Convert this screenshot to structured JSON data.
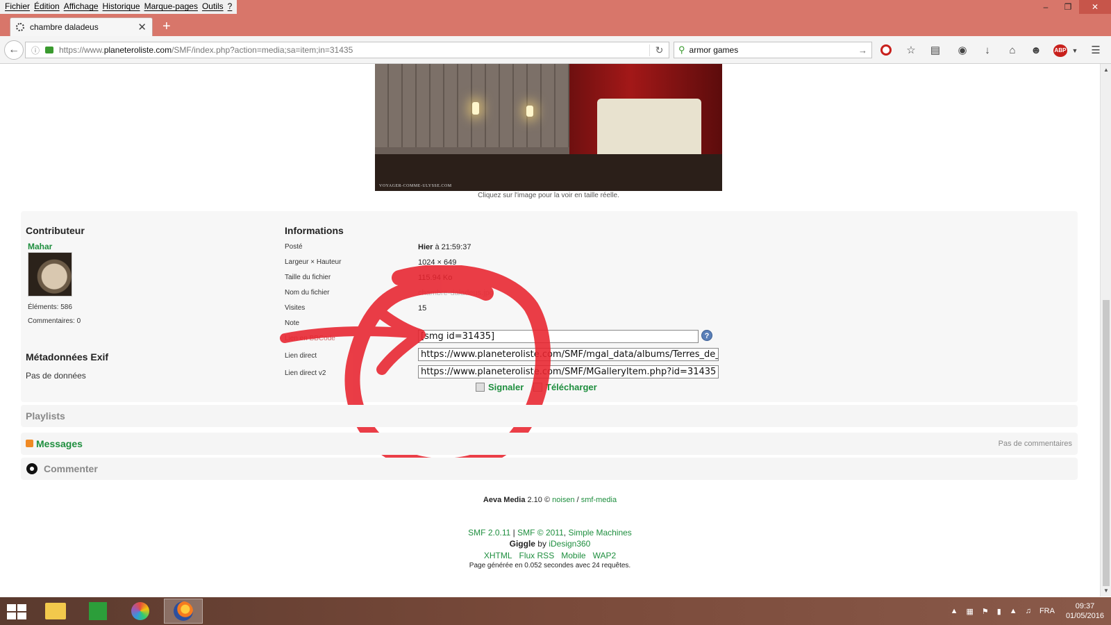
{
  "browser": {
    "menu": [
      "Fichier",
      "Édition",
      "Affichage",
      "Historique",
      "Marque-pages",
      "Outils",
      "?"
    ],
    "window_controls": {
      "minimize": "–",
      "maximize": "❐",
      "close": "✕"
    },
    "tab_title": "chambre daladeus",
    "tab_close": "✕",
    "new_tab": "+",
    "url_prefix": "https://www.",
    "url_domain": "planeteroliste.com",
    "url_path": "/SMF/index.php?action=media;sa=item;in=31435",
    "search_value": "armor games",
    "abp_label": "ABP"
  },
  "photo": {
    "watermark": "VOYAGER-COMME-ULYSSE.COM",
    "caption": "Cliquez sur l'image pour la voir en taille réelle."
  },
  "contributor": {
    "heading": "Contributeur",
    "name": "Mahar",
    "elements": "Éléments: 586",
    "comments": "Commentaires: 0"
  },
  "exif": {
    "heading": "Métadonnées Exif",
    "none": "Pas de données"
  },
  "info": {
    "heading": "Informations",
    "rows": [
      {
        "label": "Posté",
        "value_bold": "Hier",
        "value": " à 21:59:37"
      },
      {
        "label": "Largeur × Hauteur",
        "value": "1024 × 649"
      },
      {
        "label": "Taille du fichier",
        "value": "115.94 Ko"
      },
      {
        "label": "Nom du fichier",
        "value": "chambre-daladeus.jpg"
      },
      {
        "label": "Visites",
        "value": "15"
      },
      {
        "label": "Note",
        "value": ""
      }
    ],
    "bbcode_label": "Lien en BBCode",
    "bbcode_value": "[smg id=31435]",
    "direct_label": "Lien direct",
    "direct_value": "https://www.planeteroliste.com/SMF/mgal_data/albums/Terres_de_L",
    "direct2_label": "Lien direct v2",
    "direct2_value": "https://www.planeteroliste.com/SMF/MGalleryItem.php?id=31435",
    "help": "?",
    "report": "Signaler",
    "download": "Télécharger"
  },
  "sections": {
    "playlists": "Playlists",
    "messages": "Messages",
    "no_comments": "Pas de commentaires",
    "comment": "Commenter"
  },
  "footer": {
    "aeva_name": "Aeva Media",
    "aeva_version": " 2.10 © ",
    "aeva_author": "noisen",
    "aeva_sep": " / ",
    "aeva_link": "smf-media",
    "smf_version": "SMF 2.0.11",
    "smf_copy": "SMF © 2011",
    "smf_sep": " | ",
    "smf_comma": ", ",
    "simple_machines": "Simple Machines",
    "giggle": "Giggle",
    "giggle_by": " by ",
    "idesign": "iDesign360",
    "xhtml": "XHTML",
    "rss": "Flux RSS",
    "mobile": "Mobile",
    "wap": "WAP2",
    "generated": "Page générée en 0.052 secondes avec 24 requêtes."
  },
  "taskbar": {
    "lang": "FRA",
    "time": "09:37",
    "date": "01/05/2016"
  },
  "colors": {
    "accent_green": "#1e8e3e",
    "titlebar": "#d8766a",
    "scribble": "#e8232e"
  }
}
